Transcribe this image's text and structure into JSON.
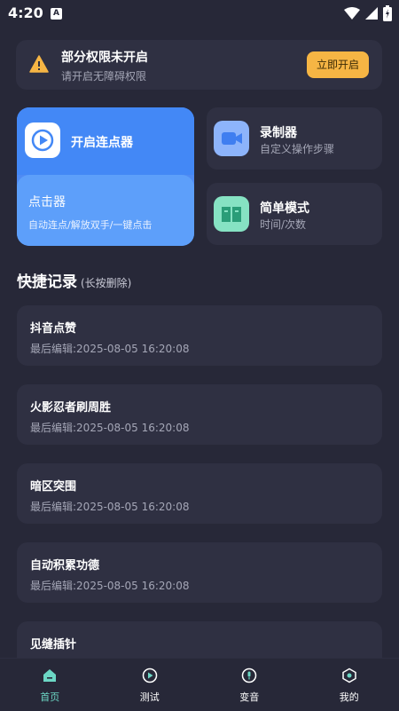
{
  "status_bar": {
    "time": "4:20",
    "badge": "A"
  },
  "permission_banner": {
    "title": "部分权限未开启",
    "subtitle": "请开启无障碍权限",
    "button": "立即开启",
    "icon": "warning-icon",
    "accent": "#f6b544"
  },
  "clicker_card": {
    "title": "开启连点器",
    "sub_title": "点击器",
    "description": "自动连点/解放双手/一键点击",
    "icon": "play-icon",
    "accent": "#4f8bf3"
  },
  "recorder_card": {
    "title": "录制器",
    "subtitle": "自定义操作步骤",
    "icon": "video-camera-icon"
  },
  "simple_mode_card": {
    "title": "简单模式",
    "subtitle": "时间/次数",
    "icon": "book-icon"
  },
  "quick_records": {
    "title": "快捷记录",
    "hint": "(长按删除)",
    "items": [
      {
        "name": "抖音点赞",
        "time": "最后编辑:2025-08-05 16:20:08"
      },
      {
        "name": "火影忍者刷周胜",
        "time": "最后编辑:2025-08-05 16:20:08"
      },
      {
        "name": "暗区突围",
        "time": "最后编辑:2025-08-05 16:20:08"
      },
      {
        "name": "自动积累功德",
        "time": "最后编辑:2025-08-05 16:20:08"
      },
      {
        "name": "见缝插针"
      }
    ]
  },
  "nav": {
    "items": [
      {
        "label": "首页",
        "icon": "home-icon",
        "active": true
      },
      {
        "label": "测试",
        "icon": "play-circle-icon"
      },
      {
        "label": "变音",
        "icon": "voice-icon"
      },
      {
        "label": "我的",
        "icon": "profile-icon"
      }
    ],
    "active_color": "#6cd7c5"
  }
}
